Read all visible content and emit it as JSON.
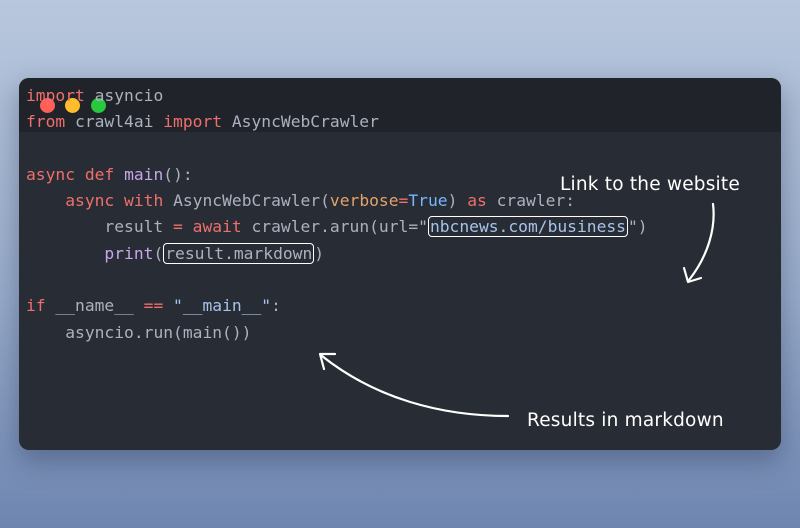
{
  "code": {
    "line1": {
      "kw": "import",
      "rest": " asyncio"
    },
    "line2": {
      "kw1": "from",
      "mod": " crawl4ai ",
      "kw2": "import",
      "cls": " AsyncWebCrawler"
    },
    "line4": {
      "kw1": "async",
      "kw2": "def",
      "fn": "main",
      "rest": "():"
    },
    "line5": {
      "kw1": "async",
      "kw2": "with",
      "cls": "AsyncWebCrawler(",
      "param": "verbose",
      "eq": "=",
      "bool": "True",
      "close": ")",
      "kw3": "as",
      "rest": " crawler:"
    },
    "line6": {
      "lhs": "result ",
      "eq": "=",
      "kw": "await",
      "call": " crawler.arun(url=\"",
      "url": "nbcnews.com/business",
      "end": "\")"
    },
    "line7": {
      "fn": "print",
      "open": "(",
      "arg": "result.markdown",
      "close": ")"
    },
    "line9": {
      "kw": "if",
      "mid": " __name__ ",
      "op": "==",
      "str": " \"__main__\"",
      "colon": ":"
    },
    "line10": {
      "rest": "asyncio.run(main())"
    }
  },
  "annotations": {
    "link_label": "Link to the website",
    "results_label": "Results in markdown"
  },
  "colors": {
    "keyword": "#ef6f6c",
    "plain": "#abb2bf",
    "function": "#c9a6ec",
    "param": "#e5a36a",
    "boolean": "#79b6ff",
    "string": "#a8c3ea",
    "editor_bg": "#282c34",
    "titlebar_bg": "#202329"
  }
}
